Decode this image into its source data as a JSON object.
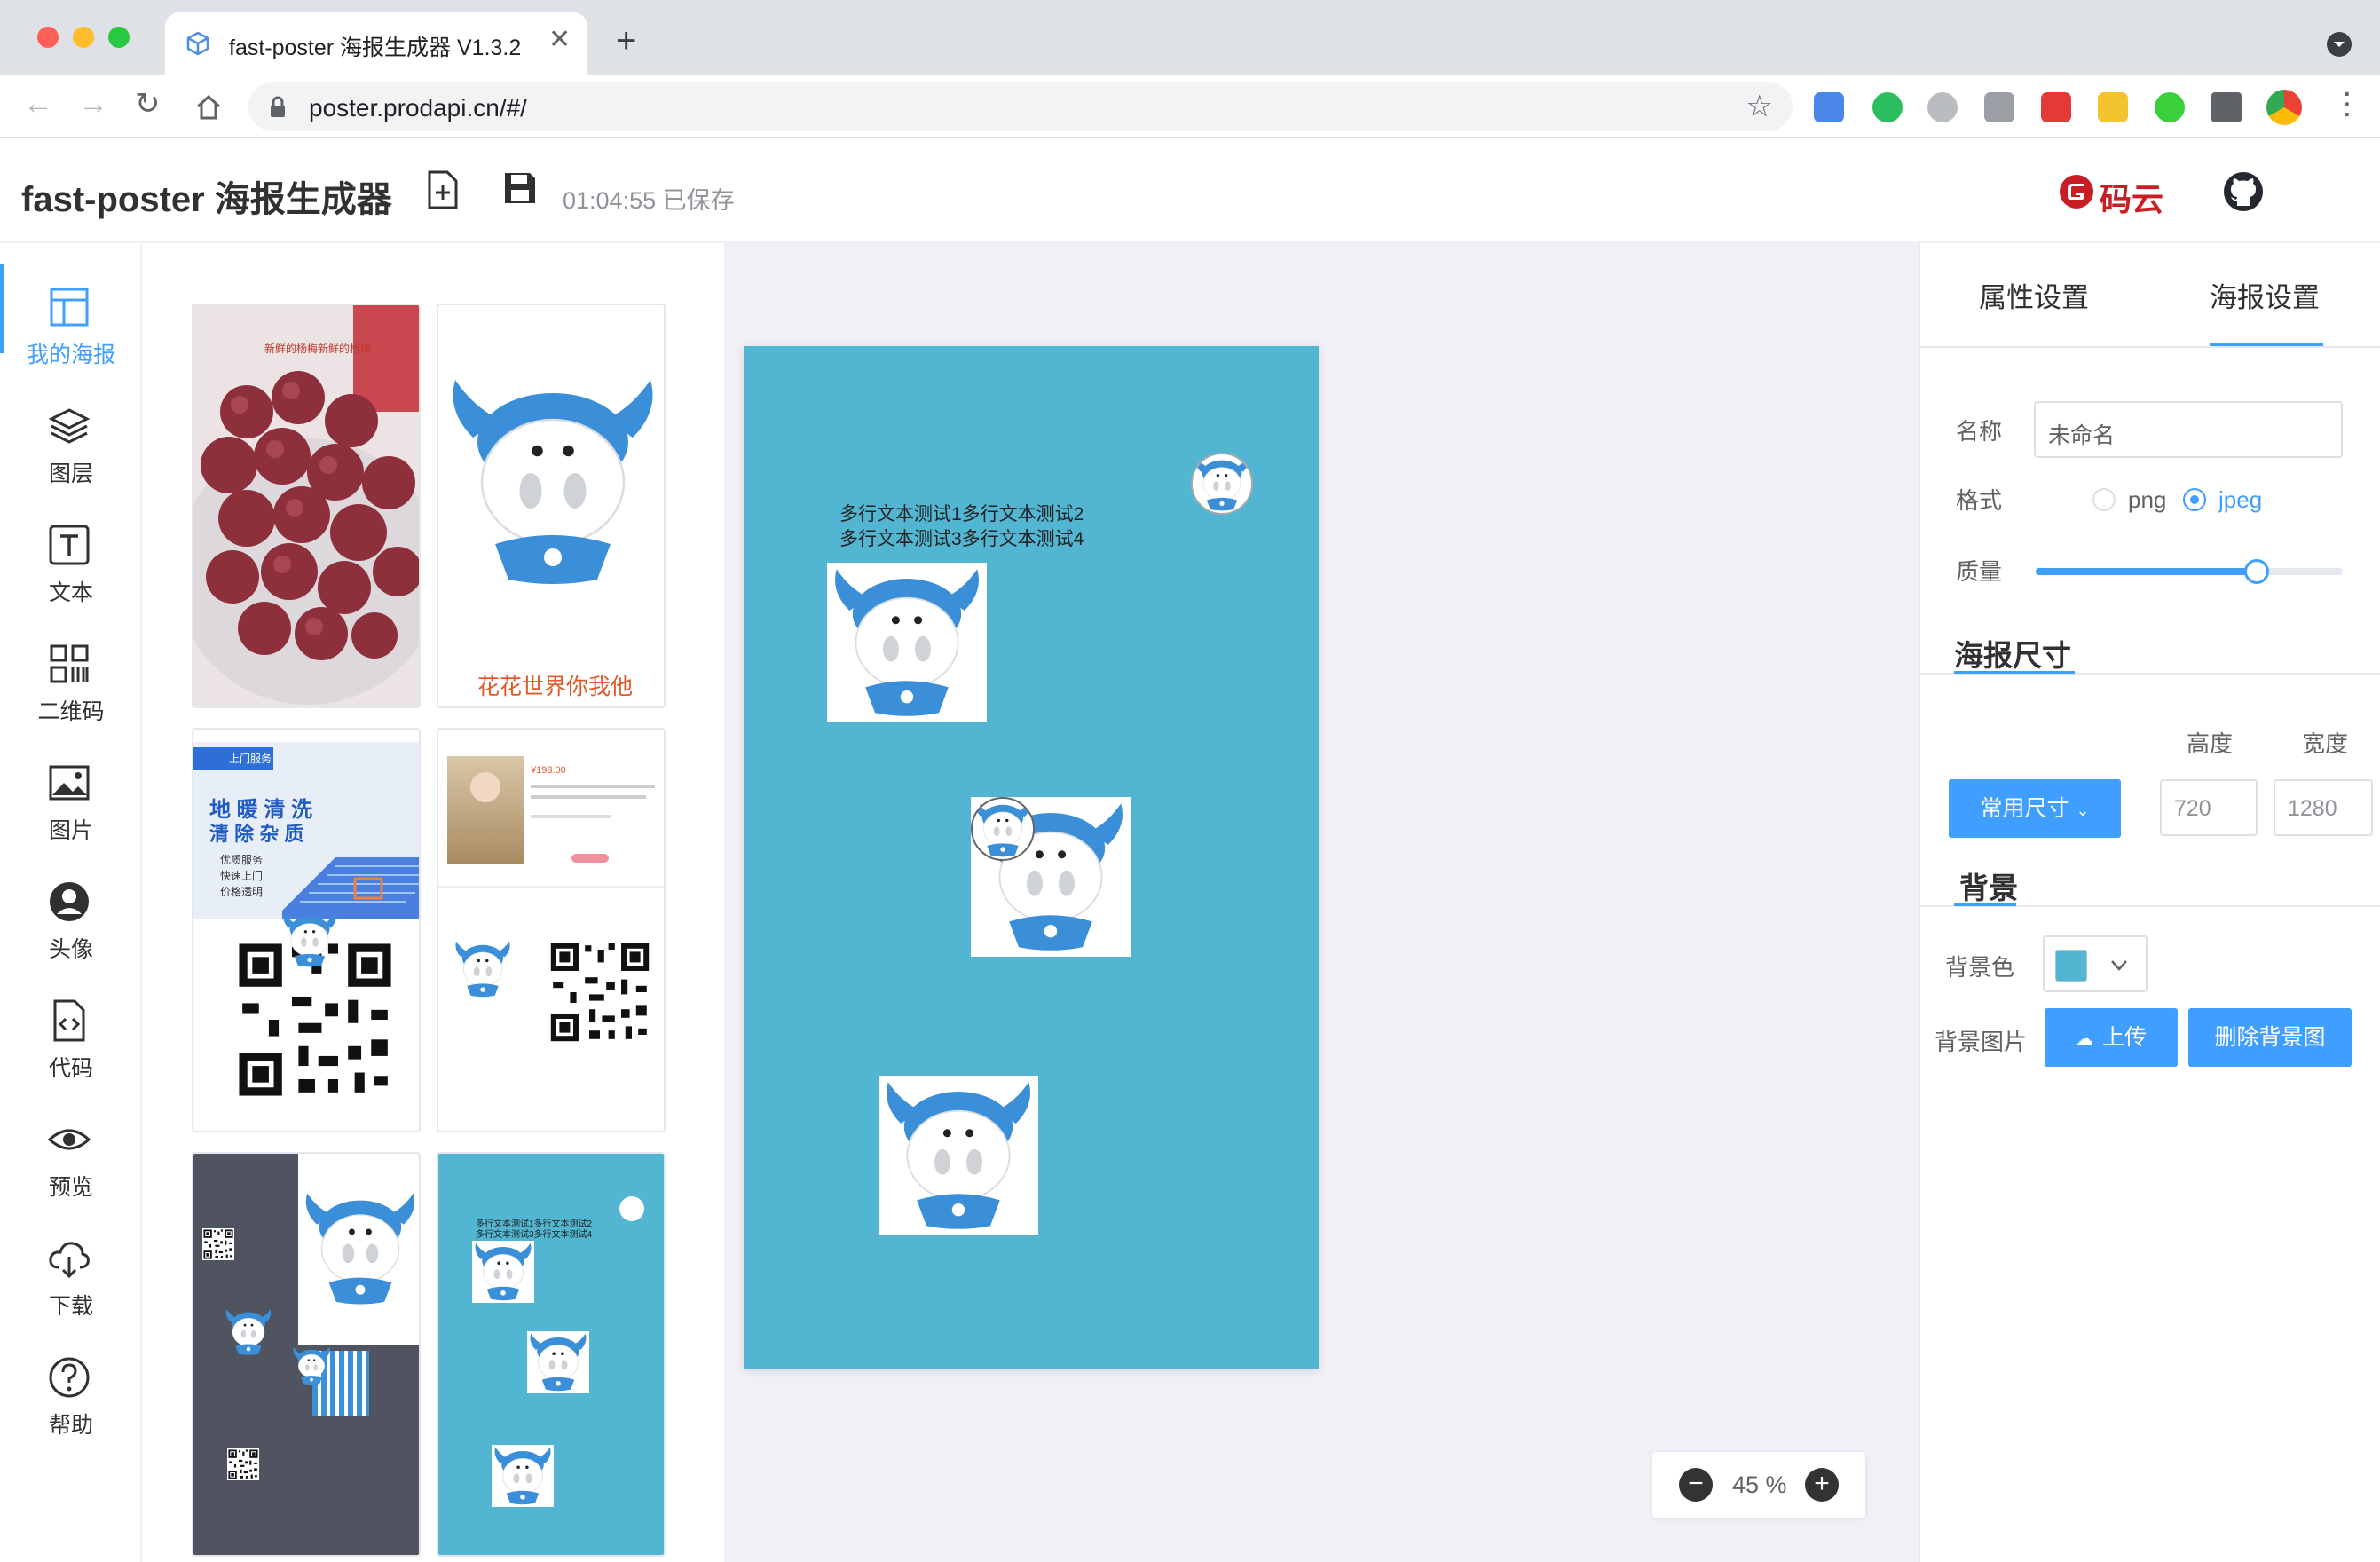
{
  "browser": {
    "tab_title": "fast-poster 海报生成器 V1.3.2",
    "url": "poster.prodapi.cn/#/"
  },
  "header": {
    "title": "fast-poster 海报生成器",
    "saved_status": "01:04:55 已保存",
    "gitee_label": "码云"
  },
  "nav": {
    "items": [
      {
        "label": "我的海报",
        "icon": "layout-icon"
      },
      {
        "label": "图层",
        "icon": "layers-icon"
      },
      {
        "label": "文本",
        "icon": "text-icon"
      },
      {
        "label": "二维码",
        "icon": "qrcode-icon"
      },
      {
        "label": "图片",
        "icon": "image-icon"
      },
      {
        "label": "头像",
        "icon": "avatar-icon"
      },
      {
        "label": "代码",
        "icon": "code-icon"
      },
      {
        "label": "预览",
        "icon": "eye-icon"
      },
      {
        "label": "下载",
        "icon": "cloud-download-icon"
      },
      {
        "label": "帮助",
        "icon": "help-icon"
      }
    ]
  },
  "templates": {
    "t1_caption": "新鲜的杨梅新鲜的杨梅",
    "t2_caption": "花花世界你我他",
    "t3_title_1": "地 暖 清 洗",
    "t3_title_2": "清 除 杂 质",
    "t3_items": [
      "优质服务",
      "快速上门",
      "价格透明"
    ],
    "t3_badge": "上门服务",
    "t4_price": "¥198.00",
    "t6_text_1": "多行文本测试1多行文本测试2",
    "t6_text_2": "多行文本测试3多行文本测试4"
  },
  "canvas": {
    "text_line_1": "多行文本测试1多行文本测试2",
    "text_line_2": "多行文本测试3多行文本测试4",
    "zoom": "45 %",
    "background_color": "#52b5d2"
  },
  "right_panel": {
    "tabs": [
      "属性设置",
      "海报设置"
    ],
    "active_tab": "海报设置",
    "name_label": "名称",
    "name_value": "未命名",
    "format_label": "格式",
    "format_options": [
      "png",
      "jpeg"
    ],
    "format_selected": "jpeg",
    "quality_label": "质量",
    "quality_value": 0.72,
    "size_section": "海报尺寸",
    "height_label": "高度",
    "width_label": "宽度",
    "size_preset_button": "常用尺寸",
    "height_value": "720",
    "width_value": "1280",
    "bg_section": "背景",
    "bg_color_label": "背景色",
    "bg_image_label": "背景图片",
    "upload_button": "上传",
    "delete_bg_button": "删除背景图"
  },
  "colors": {
    "accent": "#409eff",
    "poster_bg": "#52b5d2",
    "mascot_blue": "#3b8fd8"
  }
}
